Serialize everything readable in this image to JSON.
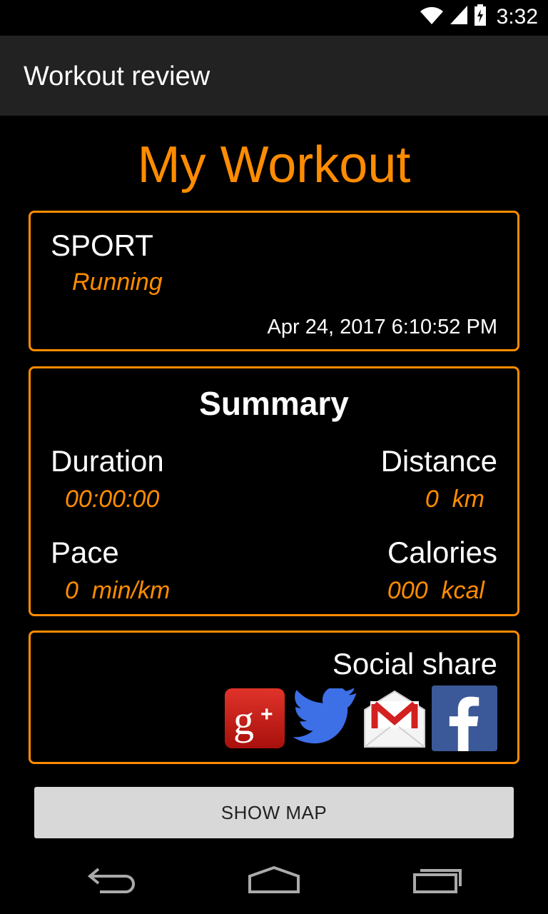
{
  "status_bar": {
    "time": "3:32",
    "icons": [
      "wifi-icon",
      "cell-signal-icon",
      "battery-charging-icon"
    ]
  },
  "action_bar": {
    "title": "Workout review"
  },
  "page": {
    "title": "My Workout"
  },
  "sport_card": {
    "label": "SPORT",
    "value": "Running",
    "date": "Apr 24, 2017 6:10:52 PM"
  },
  "summary_card": {
    "title": "Summary",
    "duration_label": "Duration",
    "duration_value": "00:00:00",
    "distance_label": "Distance",
    "distance_value": "0  km",
    "pace_label": "Pace",
    "pace_value": "0  min/km",
    "calories_label": "Calories",
    "calories_value": "000  kcal"
  },
  "social_card": {
    "label": "Social share",
    "icons": [
      "google-plus-icon",
      "twitter-icon",
      "gmail-icon",
      "facebook-icon"
    ]
  },
  "buttons": {
    "show_map": "SHOW MAP"
  },
  "nav_bar": {
    "icons": [
      "back-icon",
      "home-icon",
      "recents-icon"
    ]
  },
  "colors": {
    "accent": "#ff8c00",
    "background": "#000000",
    "action_bar": "#222222",
    "button_bg": "#d8d8d8"
  }
}
